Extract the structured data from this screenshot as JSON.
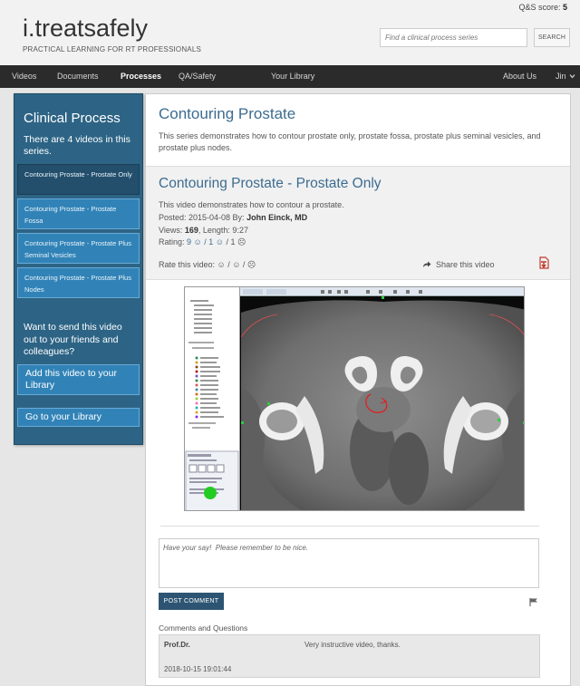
{
  "header": {
    "qs_score_label": "Q&S score:",
    "qs_score_value": "5",
    "brand": "i.treatsafely",
    "tagline": "PRACTICAL LEARNING FOR RT PROFESSIONALS",
    "search_placeholder": "Find a clinical process series",
    "search_button": "SEARCH"
  },
  "nav": {
    "items": [
      "Videos",
      "Documents",
      "Processes",
      "QA/Safety",
      "Your Library",
      "About Us",
      "Jin"
    ],
    "active": "Processes"
  },
  "sidebar": {
    "title": "Clinical Process",
    "count_text": "There are 4 videos in this series.",
    "videos": [
      "Contouring Prostate - Prostate Only",
      "Contouring Prostate - Prostate Fossa",
      "Contouring Prostate - Prostate Plus Seminal Vesicles",
      "Contouring Prostate - Prostate Plus Nodes"
    ],
    "share_text": "Want to send this video out to your friends and colleagues?",
    "add_library": "Add this video to your Library",
    "go_library": "Go to your Library"
  },
  "series": {
    "title": "Contouring Prostate",
    "description": "This series demonstrates how to contour prostate only, prostate fossa, prostate plus seminal vesicles, and prostate plus nodes."
  },
  "video": {
    "title": "Contouring Prostate - Prostate Only",
    "description": "This video demonstrates how to contour a prostate.",
    "posted_label": "Posted: 2015-04-08 By:",
    "author": "John Einck, MD",
    "views_label": "Views:",
    "views": "169",
    "length_label": ", Length: 9:27",
    "rating_label": "Rating:",
    "rating_value": "9 ☺ / 1 ☺",
    "rating_rest": " / 1 ☹",
    "rate_label": "Rate this video: ☺ / ☺  / ☹",
    "share_label": "Share this video"
  },
  "comments": {
    "placeholder": "Have your say!  Please remember to be nice.",
    "post_button": "POST COMMENT",
    "section_label": "Comments and Questions",
    "items": [
      {
        "author": "Prof.Dr.",
        "text": "Very instructive video, thanks.",
        "date": "2018-10-15 19:01:44"
      }
    ]
  },
  "colors": {
    "accent": "#3c6c90",
    "sidebar_bg": "#2d6485",
    "sidebar_item": "#3183b7",
    "navbar": "#2b2b2b",
    "pdf_red": "#c0392b"
  }
}
